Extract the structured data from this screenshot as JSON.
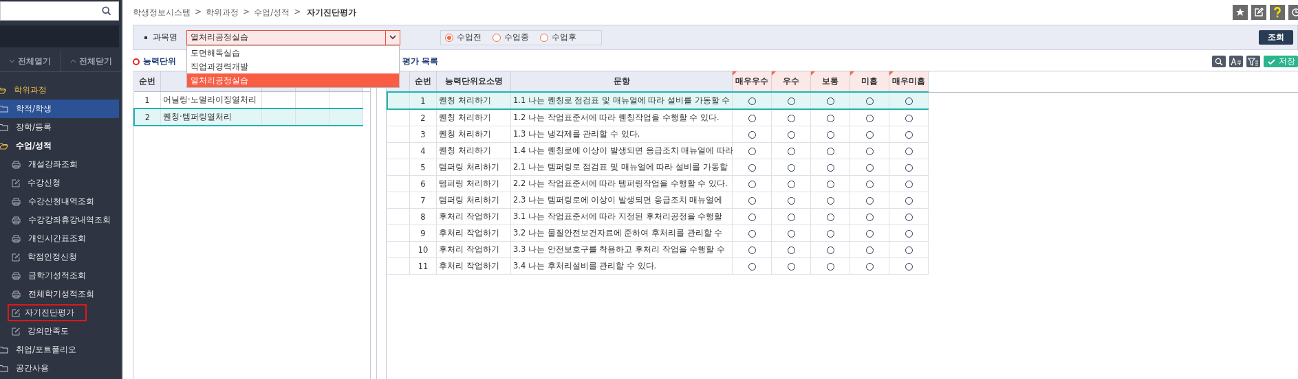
{
  "sidebar": {
    "expand_all": "전체열기",
    "collapse_all": "전체닫기",
    "menu": [
      {
        "label": "학위과정",
        "expanded": true,
        "selected": false,
        "children": [
          {
            "label": "학적/학생",
            "expanded": false,
            "selected": true
          },
          {
            "label": "장학/등록",
            "expanded": false,
            "selected": false
          },
          {
            "label": "수업/성적",
            "expanded": true,
            "selected": false,
            "children": [
              {
                "label": "개설강좌조회",
                "kind": "view",
                "selected": false,
                "outlined": false
              },
              {
                "label": "수강신청",
                "kind": "form",
                "selected": false,
                "outlined": false
              },
              {
                "label": "수강신청내역조회",
                "kind": "view",
                "selected": false,
                "outlined": false
              },
              {
                "label": "수강강좌휴강내역조회",
                "kind": "view",
                "selected": false,
                "outlined": false
              },
              {
                "label": "개인시간표조회",
                "kind": "view",
                "selected": false,
                "outlined": false
              },
              {
                "label": "학점인정신청",
                "kind": "form",
                "selected": false,
                "outlined": false
              },
              {
                "label": "금학기성적조회",
                "kind": "view",
                "selected": false,
                "outlined": false
              },
              {
                "label": "전체학기성적조회",
                "kind": "view",
                "selected": false,
                "outlined": false
              },
              {
                "label": "자기진단평가",
                "kind": "form",
                "selected": false,
                "outlined": true
              },
              {
                "label": "강의만족도",
                "kind": "form",
                "selected": false,
                "outlined": false
              }
            ]
          },
          {
            "label": "취업/포트폴리오",
            "expanded": false,
            "selected": false
          },
          {
            "label": "공간사용",
            "expanded": false,
            "selected": false
          }
        ]
      }
    ]
  },
  "breadcrumb": {
    "separator": ">",
    "items": [
      "학생정보시스템",
      "학위과정",
      "수업/성적",
      "자기진단평가"
    ]
  },
  "search": {
    "label": "과목명",
    "course": {
      "value": "열처리공정실습",
      "options": [
        {
          "label": "도면해독실습",
          "selected": false
        },
        {
          "label": "직업과경력개발",
          "selected": false
        },
        {
          "label": "열처리공정실습",
          "selected": true
        }
      ]
    },
    "phases": [
      {
        "label": "수업전",
        "selected": true
      },
      {
        "label": "수업중",
        "selected": false
      },
      {
        "label": "수업후",
        "selected": false
      }
    ],
    "query_button": "조회"
  },
  "units": {
    "title": "능력단위",
    "columns": [
      "순번"
    ],
    "rows": [
      {
        "no": "1",
        "name": "어닐링·노멀라이징열처리",
        "selected": false
      },
      {
        "no": "2",
        "name": "퀜칭·템퍼링열처리",
        "selected": true
      }
    ]
  },
  "evaluation": {
    "title": "평가 목록",
    "save_button": "저장",
    "columns": [
      "순번",
      "능력단위요소명",
      "문항"
    ],
    "grades": [
      "매우우수",
      "우수",
      "보통",
      "미흡",
      "매우미흡"
    ],
    "rows": [
      {
        "no": "1",
        "unit": "퀜칭 처리하기",
        "item": "1.1 나는 퀜칭로 점검표 및 매뉴얼에 따라 설비를 가동할 수",
        "selected": true,
        "ratings": [
          false,
          false,
          false,
          false,
          false
        ]
      },
      {
        "no": "2",
        "unit": "퀜칭 처리하기",
        "item": "1.2 나는 작업표준서에 따라 퀜칭작업을 수행할 수 있다.",
        "selected": false,
        "ratings": [
          false,
          false,
          false,
          false,
          false
        ]
      },
      {
        "no": "3",
        "unit": "퀜칭 처리하기",
        "item": "1.3 나는 냉각제를 관리할 수 있다.",
        "selected": false,
        "ratings": [
          false,
          false,
          false,
          false,
          false
        ]
      },
      {
        "no": "4",
        "unit": "퀜칭 처리하기",
        "item": "1.4 나는 퀜칭로에 이상이 발생되면 응급조치 매뉴얼에 따라",
        "selected": false,
        "ratings": [
          false,
          false,
          false,
          false,
          false
        ]
      },
      {
        "no": "5",
        "unit": "템퍼링 처리하기",
        "item": "2.1 나는 템퍼링로 점검표 및 매뉴얼에 따라 설비를 가동할",
        "selected": false,
        "ratings": [
          false,
          false,
          false,
          false,
          false
        ]
      },
      {
        "no": "6",
        "unit": "템퍼링 처리하기",
        "item": "2.2 나는 작업표준서에 따라 템퍼링작업을 수행할 수 있다.",
        "selected": false,
        "ratings": [
          false,
          false,
          false,
          false,
          false
        ]
      },
      {
        "no": "7",
        "unit": "템퍼링 처리하기",
        "item": "2.3 나는 템퍼링로에 이상이 발생되면 응급조치 매뉴얼에",
        "selected": false,
        "ratings": [
          false,
          false,
          false,
          false,
          false
        ]
      },
      {
        "no": "8",
        "unit": "후처리 작업하기",
        "item": "3.1 나는 작업표준서에 따라 지정된 후처리공정을 수행할",
        "selected": false,
        "ratings": [
          false,
          false,
          false,
          false,
          false
        ]
      },
      {
        "no": "9",
        "unit": "후처리 작업하기",
        "item": "3.2 나는 물질안전보건자료에 준하여 후처리를 관리할 수",
        "selected": false,
        "ratings": [
          false,
          false,
          false,
          false,
          false
        ]
      },
      {
        "no": "10",
        "unit": "후처리 작업하기",
        "item": "3.3 나는 안전보호구를 착용하고 후처리 작업을 수행할 수",
        "selected": false,
        "ratings": [
          false,
          false,
          false,
          false,
          false
        ]
      },
      {
        "no": "11",
        "unit": "후처리 작업하기",
        "item": "3.4 나는 후처리설비를 관리할 수 있다.",
        "selected": false,
        "ratings": [
          false,
          false,
          false,
          false,
          false
        ]
      }
    ]
  }
}
